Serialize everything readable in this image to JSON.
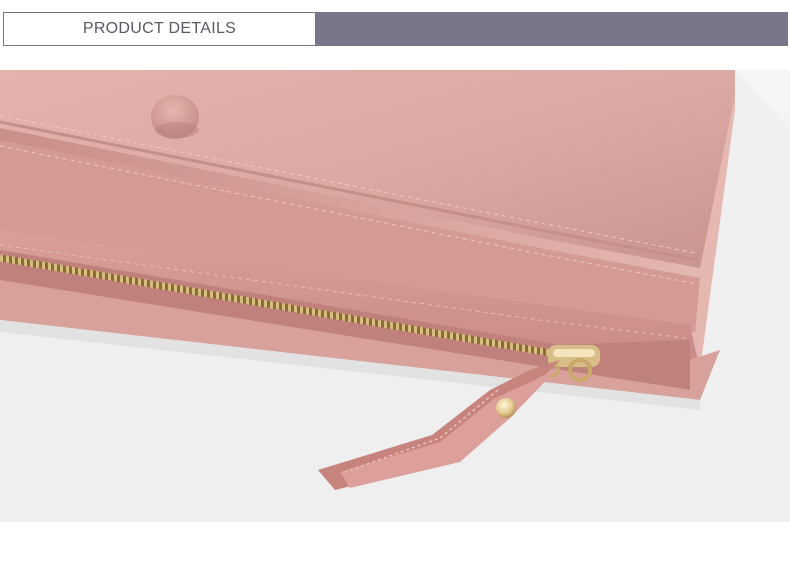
{
  "header": {
    "title": "PRODUCT DETAILS"
  },
  "photo": {
    "subject_icon": "pink-wallet-zipper-closeup",
    "colors": {
      "leather": "#d9a39e",
      "leather_dark": "#b97f7b",
      "zipper_gold": "#c9a86a",
      "header_bar": "#7a7689"
    }
  }
}
